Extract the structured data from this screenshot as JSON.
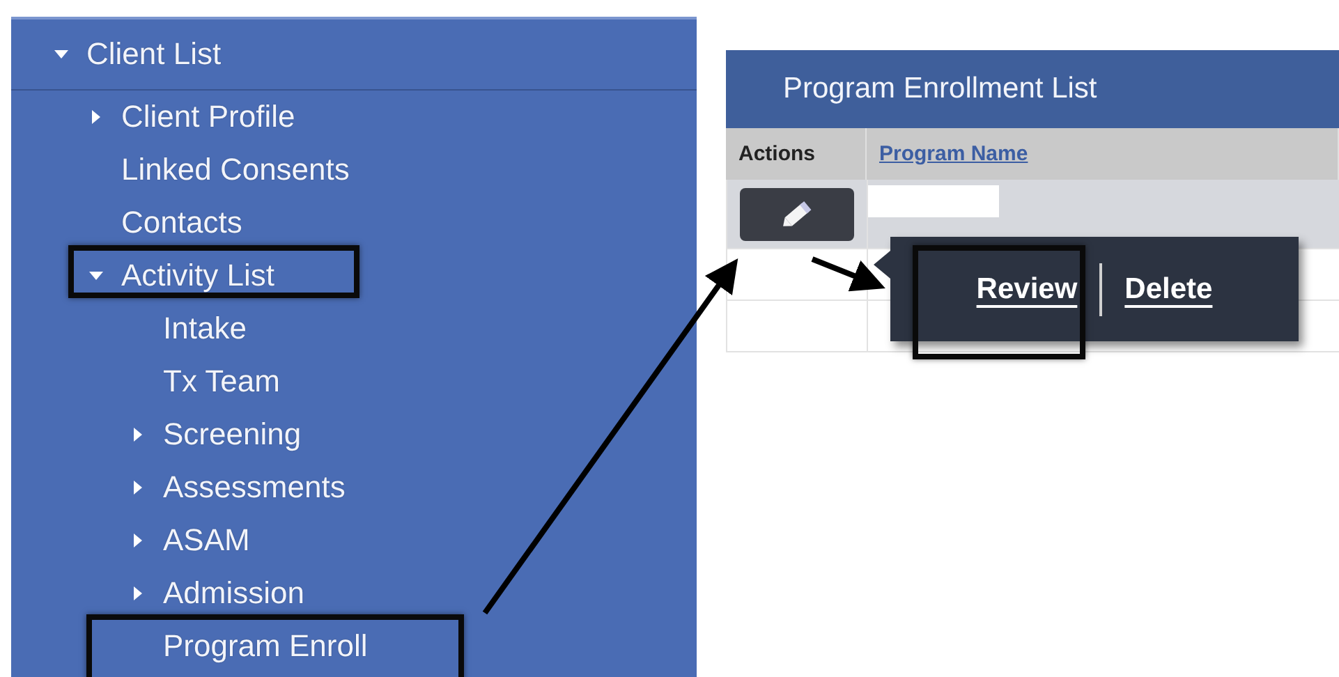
{
  "sidebar": {
    "title": "Client List",
    "expanded": true,
    "items": [
      {
        "label": "Client Profile",
        "kind": "group",
        "expanded": false
      },
      {
        "label": "Linked Consents",
        "kind": "leaf"
      },
      {
        "label": "Contacts",
        "kind": "leaf"
      },
      {
        "label": "Activity List",
        "kind": "group",
        "expanded": true,
        "children": [
          {
            "label": "Intake",
            "kind": "leaf"
          },
          {
            "label": "Tx Team",
            "kind": "leaf"
          },
          {
            "label": "Screening",
            "kind": "group",
            "expanded": false
          },
          {
            "label": "Assessments",
            "kind": "group",
            "expanded": false
          },
          {
            "label": "ASAM",
            "kind": "group",
            "expanded": false
          },
          {
            "label": "Admission",
            "kind": "group",
            "expanded": false
          },
          {
            "label": "Program Enroll",
            "kind": "leaf"
          }
        ]
      }
    ]
  },
  "panel": {
    "title": "Program Enrollment List",
    "table": {
      "columns": [
        "Actions",
        "Program Name"
      ],
      "rows": [
        {
          "kind": "edit"
        },
        {
          "kind": "empty"
        },
        {
          "kind": "empty"
        }
      ]
    },
    "popover": {
      "items": [
        "Review",
        "Delete"
      ]
    }
  }
}
